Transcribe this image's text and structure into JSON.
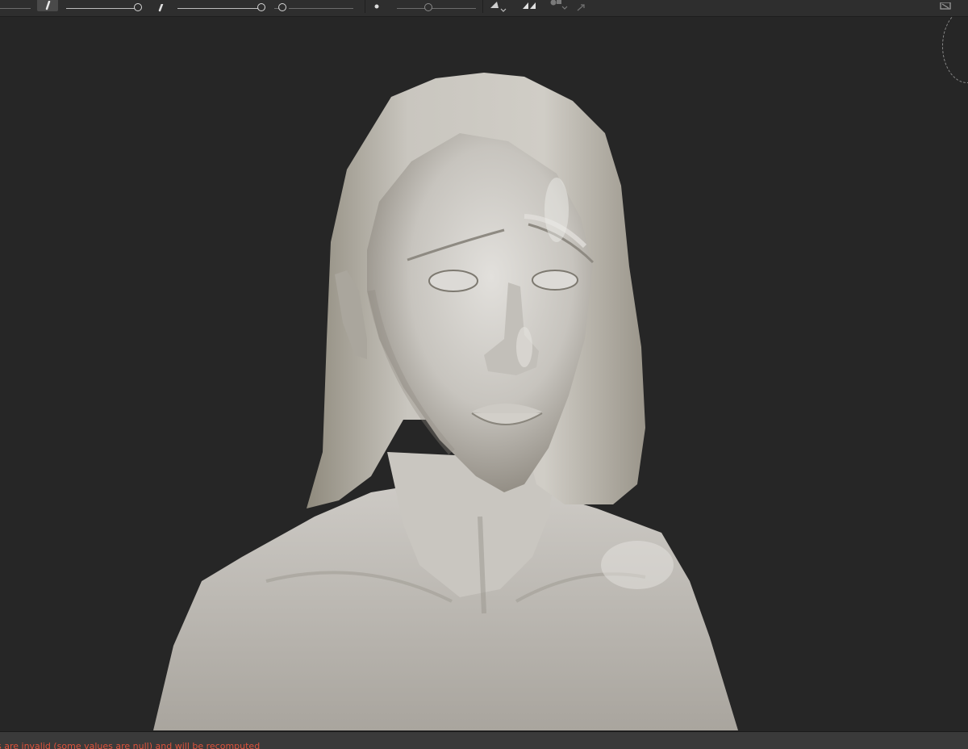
{
  "toolbar": {
    "tools": [
      "brush-tool",
      "pen-tool",
      "dot-tool",
      "shape-tool",
      "symmetry-tool",
      "mask-tool",
      "export-tool"
    ],
    "sliders": [
      {
        "name": "brush-size",
        "value": 0.95
      },
      {
        "name": "brush-strength",
        "value": 0.85
      },
      {
        "name": "spacing",
        "value": 0.5
      }
    ]
  },
  "viewport": {
    "content": "sculpt-model-bust",
    "colors": {
      "background": "#262626",
      "model": "#c4c1bc"
    }
  },
  "status": {
    "message": "s are invalid (some values are null) and will be recomputed"
  }
}
